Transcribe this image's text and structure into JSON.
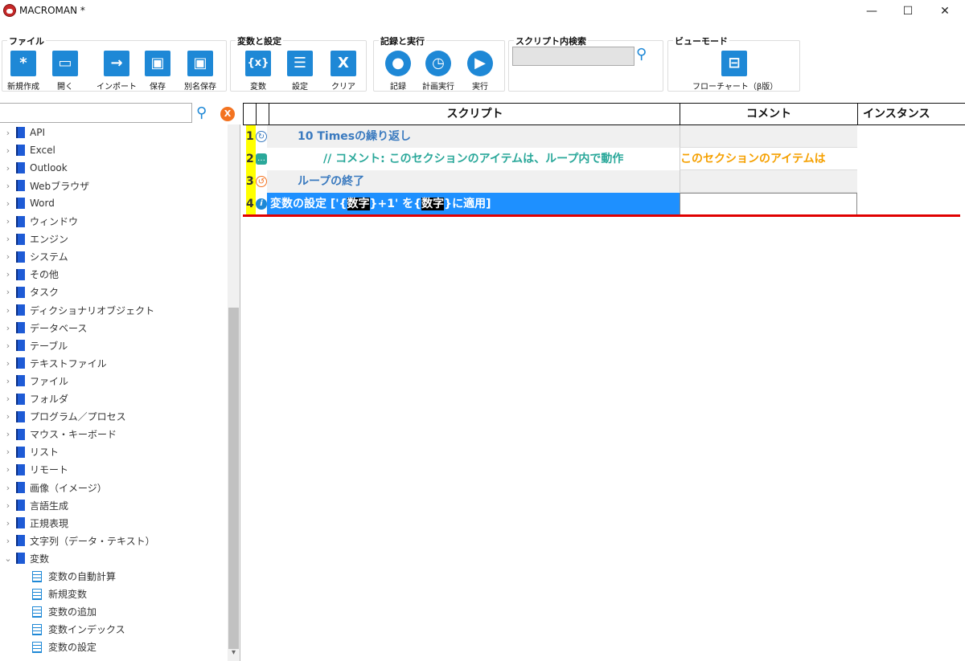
{
  "window": {
    "title": "MACROMAN *",
    "minimize": "—",
    "maximize": "☐",
    "close": "✕"
  },
  "ribbon": {
    "file": {
      "title": "ファイル",
      "buttons": [
        {
          "label": "新規作成",
          "icon": "*"
        },
        {
          "label": "開く",
          "icon": "▭"
        },
        {
          "label": "インポート",
          "icon": "→"
        },
        {
          "label": "保存",
          "icon": "▣"
        },
        {
          "label": "別名保存",
          "icon": "▣"
        }
      ]
    },
    "vars": {
      "title": "変数と設定",
      "buttons": [
        {
          "label": "変数",
          "icon": "{x}"
        },
        {
          "label": "設定",
          "icon": "☰"
        },
        {
          "label": "クリア",
          "icon": "X"
        }
      ]
    },
    "record": {
      "title": "記録と実行",
      "buttons": [
        {
          "label": "記録",
          "icon": "●"
        },
        {
          "label": "計画実行",
          "icon": "◷"
        },
        {
          "label": "実行",
          "icon": "▶"
        }
      ]
    },
    "search": {
      "title": "スクリプト内検索",
      "value": ""
    },
    "view": {
      "title": "ビューモード",
      "buttons": [
        {
          "label": "フローチャート（β版）",
          "icon": "⊟"
        }
      ]
    }
  },
  "tree": {
    "search_value": "",
    "clear_label": "X",
    "items": [
      "API",
      "Excel",
      "Outlook",
      "Webブラウザ",
      "Word",
      "ウィンドウ",
      "エンジン",
      "システム",
      "その他",
      "タスク",
      "ディクショナリオブジェクト",
      "データベース",
      "テーブル",
      "テキストファイル",
      "ファイル",
      "フォルダ",
      "プログラム／プロセス",
      "マウス・キーボード",
      "リスト",
      "リモート",
      "画像（イメージ）",
      "言語生成",
      "正規表現",
      "文字列（データ・テキスト）",
      "変数"
    ],
    "expanded_children": [
      "変数の自動計算",
      "新規変数",
      "変数の追加",
      "変数インデックス",
      "変数の設定"
    ]
  },
  "grid": {
    "headers": {
      "script": "スクリプト",
      "comment": "コメント",
      "instance": "インスタンス"
    },
    "rows": [
      {
        "num": "1",
        "script": "10 Timesの繰り返し",
        "comment": ""
      },
      {
        "num": "2",
        "script": "// コメント: このセクションのアイテムは、ループ内で動作",
        "comment": "このセクションのアイテムは"
      },
      {
        "num": "3",
        "script": "ループの終了",
        "comment": ""
      },
      {
        "num": "4",
        "script_parts": [
          "変数の設定 ['{",
          "数字",
          "}+1' を{",
          "数字",
          "}に適用]"
        ],
        "comment": ""
      }
    ]
  },
  "colors": {
    "accent": "#1e88d6",
    "selection": "#1e90ff",
    "loop_text": "#3a7abf",
    "comment_text": "#2aa89a",
    "comment_col_text": "#f5a000",
    "error_line": "#e00000"
  }
}
